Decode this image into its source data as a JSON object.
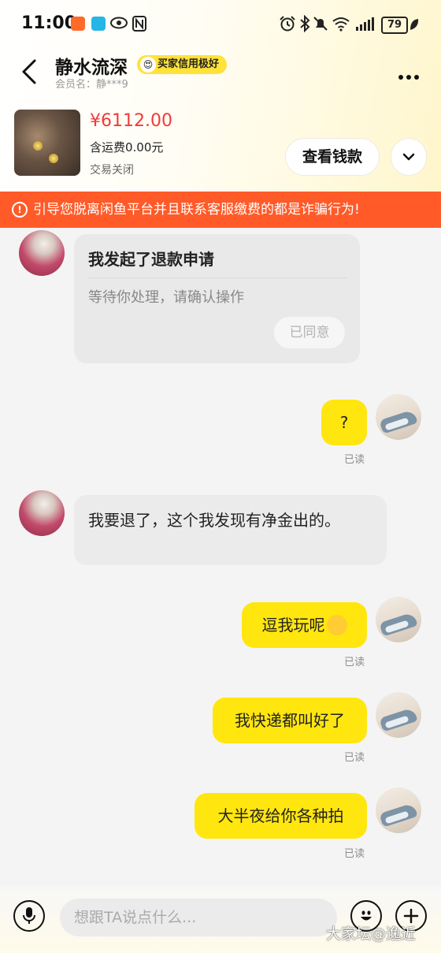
{
  "status_bar": {
    "time": "11:00",
    "battery": "79"
  },
  "header": {
    "title": "静水流深",
    "badge": "买家信用极好",
    "member": "会员名：静***9"
  },
  "product": {
    "price": "¥6112.00",
    "shipping": "含运费0.00元",
    "status": "交易关闭",
    "view_button": "查看钱款"
  },
  "warning": "引导您脱离闲鱼平台并且联系客服缴费的都是诈骗行为!",
  "chat": {
    "refund_card": {
      "title": "我发起了退款申请",
      "subtitle": "等待你处理，请确认操作",
      "button": "已同意"
    },
    "messages": [
      {
        "side": "right",
        "text": "?",
        "read": "已读"
      },
      {
        "side": "left",
        "text": "我要退了，这个我发现有净金出的。"
      },
      {
        "side": "right",
        "text": "逗我玩呢",
        "read": "已读"
      },
      {
        "side": "right",
        "text": "我快递都叫好了",
        "read": "已读"
      },
      {
        "side": "right",
        "text": "大半夜给你各种拍",
        "read": "已读"
      }
    ]
  },
  "input": {
    "placeholder": "想跟TA说点什么..."
  },
  "watermark": "大家坛@逸近",
  "colors": {
    "accent_yellow": "#ffe60f",
    "warning_orange": "#ff5a28",
    "price_red": "#f23a3a"
  }
}
